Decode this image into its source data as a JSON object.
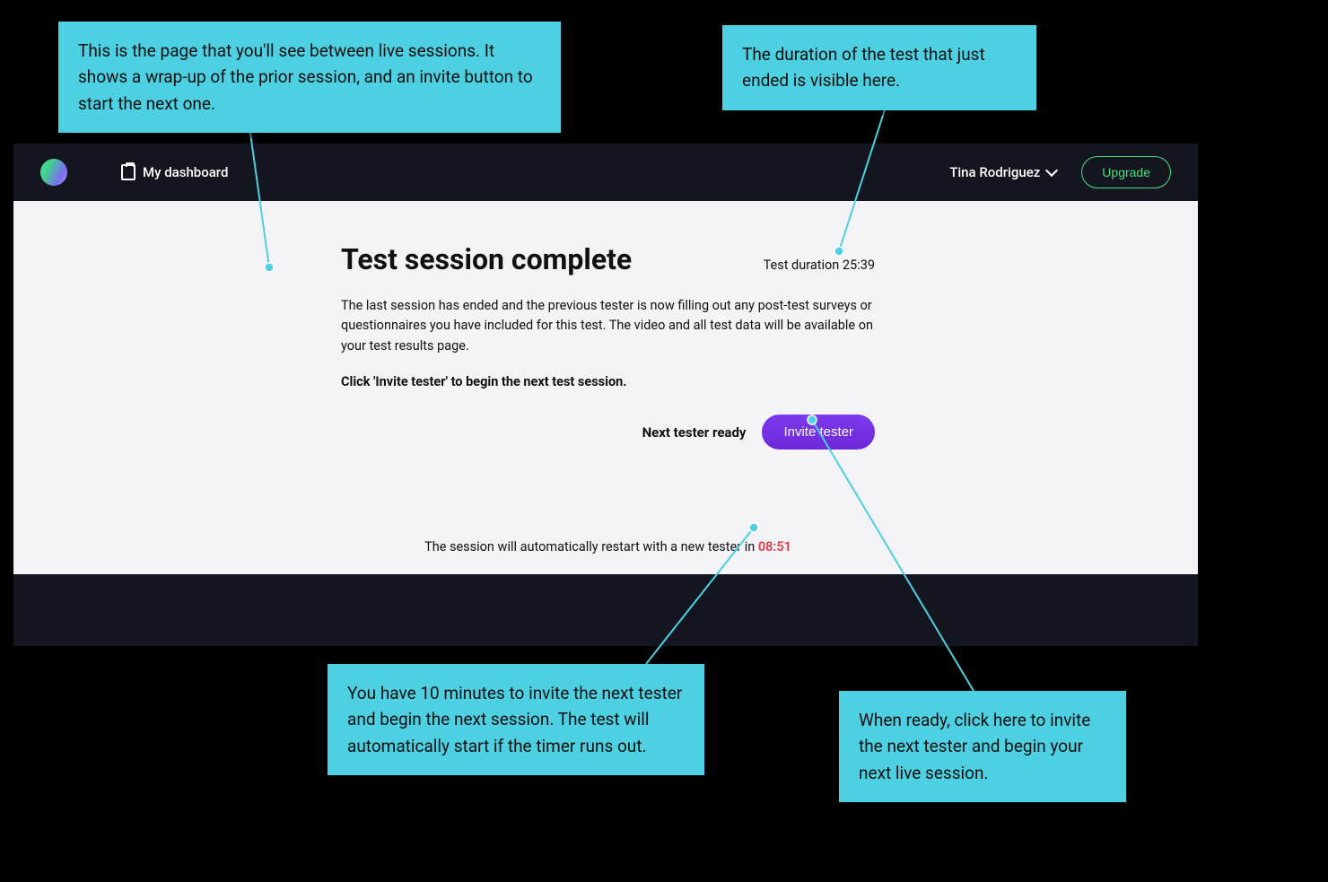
{
  "nav": {
    "dashboard_label": "My dashboard",
    "user_name": "Tina Rodriguez",
    "upgrade_label": "Upgrade"
  },
  "session": {
    "title": "Test session complete",
    "duration_label": "Test duration 25:39",
    "description": "The last session has ended and the previous tester is now filling out any post-test surveys or questionnaires you have included for this test. The video and all test data will be available on your test results page.",
    "instruction": "Click 'Invite tester' to begin the next test session.",
    "next_tester_ready": "Next tester ready",
    "invite_button_label": "Invite tester",
    "restart_prefix": "The session will automatically restart with a new tester in ",
    "restart_timer": "08:51"
  },
  "callouts": {
    "c1": "This is the page that you'll see between live sessions. It shows a wrap-up of the prior session, and an invite button to start the next one.",
    "c2": "The duration of the test that just ended is visible here.",
    "c3": "You have 10 minutes to invite the next tester and begin the next session. The test will automatically start if the timer runs out.",
    "c4": "When ready, click here to invite the next tester and begin your next live session."
  }
}
